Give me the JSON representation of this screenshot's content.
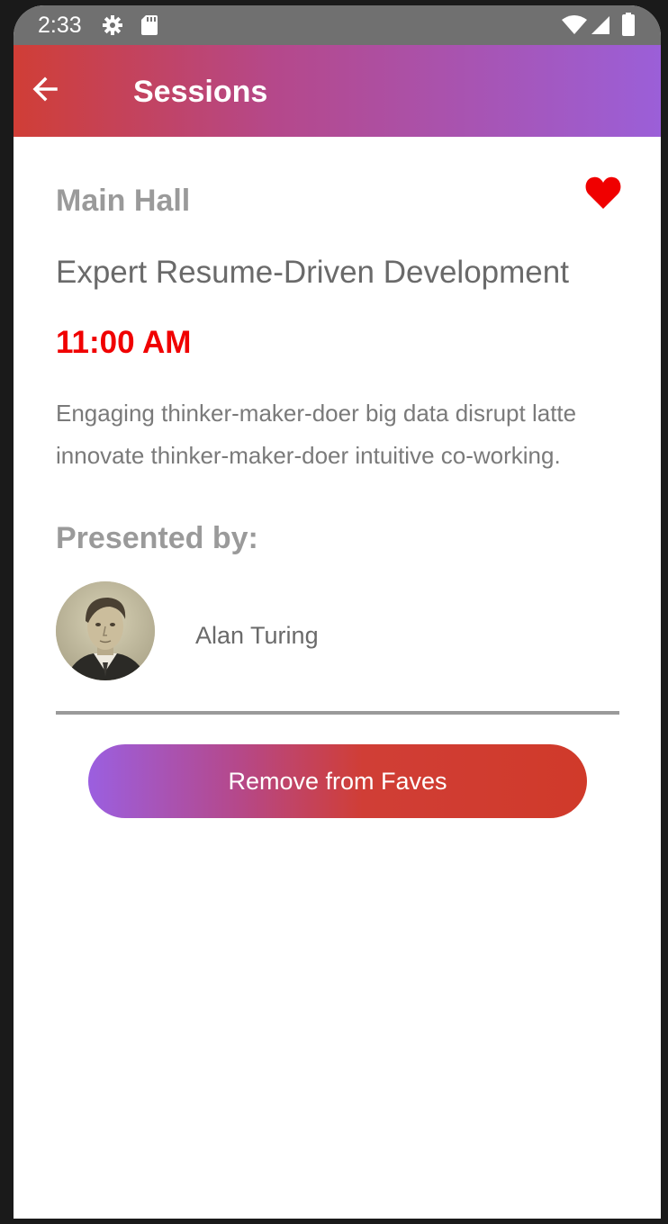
{
  "status_bar": {
    "time": "2:33",
    "icons": [
      "settings-icon",
      "sd-card-icon",
      "wifi-icon",
      "signal-icon",
      "battery-icon"
    ]
  },
  "app_bar": {
    "back_icon": "arrow-back-icon",
    "title": "Sessions",
    "gradient_colors": [
      "#d03e36",
      "#b5488a",
      "#9b5fd8"
    ]
  },
  "session": {
    "room": "Main Hall",
    "is_favorite": true,
    "favorite_icon": "heart-icon",
    "favorite_color": "#f00000",
    "title": "Expert Resume-Driven Development",
    "time": "11:00 AM",
    "time_color": "#f00000",
    "description": "Engaging thinker-maker-doer big data disrupt latte innovate thinker-maker-doer intuitive co-working."
  },
  "presenters": {
    "heading": "Presented by:",
    "items": [
      {
        "name": "Alan Turing",
        "avatar": "speaker-photo"
      }
    ]
  },
  "fave_button": {
    "label": "Remove from Faves"
  }
}
